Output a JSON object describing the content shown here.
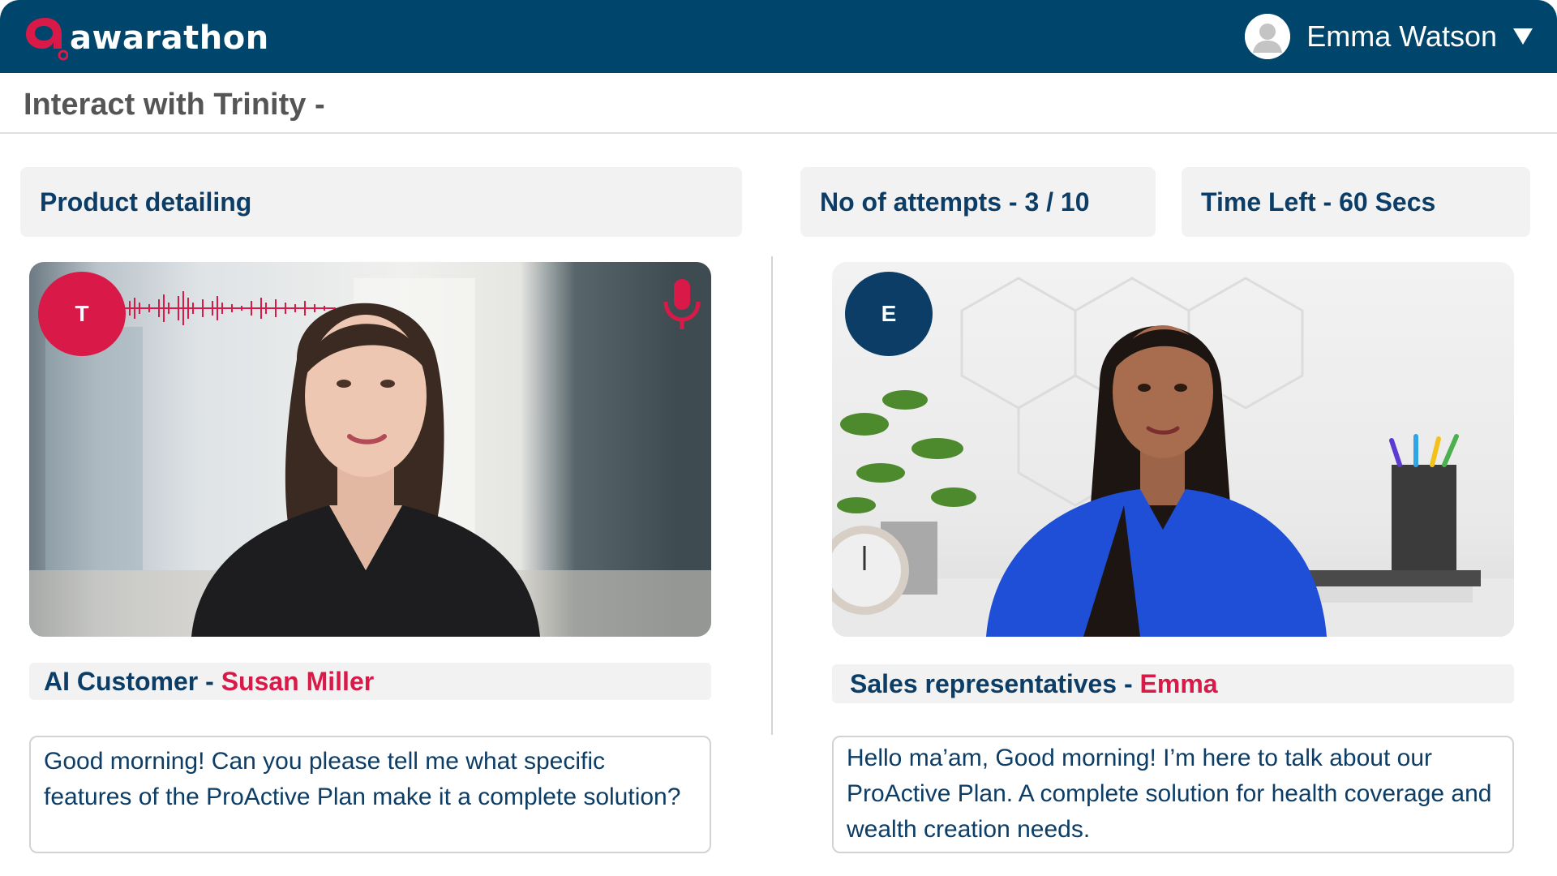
{
  "header": {
    "brand": "awarathon",
    "user_name": "Emma Watson",
    "icons": [
      "logo-icon",
      "user-avatar-icon",
      "dropdown-caret-icon"
    ],
    "colors": {
      "bar": "#00456b",
      "brand_accent": "#d91a48"
    }
  },
  "page": {
    "title": "Interact with Trinity -"
  },
  "session": {
    "mode": "Product detailing",
    "attempts": "No of attempts - 3 / 10",
    "time_left": "Time Left - 60 Secs"
  },
  "ai_panel": {
    "initial": "T",
    "role_label": "AI Customer -",
    "name": "Susan Miller",
    "message": "Good morning! Can you please tell me what specific features of the ProActive Plan make it a complete solution?",
    "icons": [
      "waveform-icon",
      "microphone-icon"
    ],
    "badge_color": "#d91a48"
  },
  "user_panel": {
    "initial": "E",
    "role_label": "Sales representatives -",
    "name": "Emma",
    "message": "Hello ma’am, Good morning! I’m here to talk about our ProActive Plan. A complete solution for health coverage and wealth creation needs.",
    "badge_color": "#0c3d66"
  }
}
